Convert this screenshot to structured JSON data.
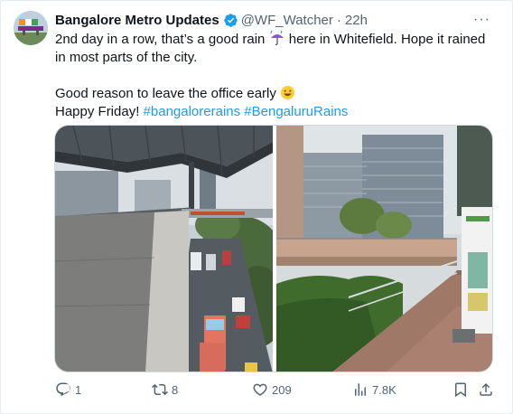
{
  "tweet": {
    "author_name": "Bangalore Metro Updates",
    "handle": "@WF_Watcher",
    "separator": "·",
    "time": "22h",
    "more_label": "···",
    "text": {
      "line1_part1": "2nd day in a row, that’s a good rain ",
      "line1_part2": " here in Whitefield. Hope it rained in most parts of the city.",
      "line2": "Good reason to leave the office early ",
      "line3_prefix": "Happy Friday! ",
      "hashtag1": "#bangalorerains",
      "hashtag_sep": " ",
      "hashtag2": "#BengaluruRains"
    },
    "emojis": [
      "umbrella-with-rain",
      "grinning-face"
    ],
    "media": [
      {
        "name": "metro-station-rainy-road-photo"
      },
      {
        "name": "office-campus-wet-walkway-photo"
      }
    ],
    "actions": {
      "replies": "1",
      "reposts": "8",
      "likes": "209",
      "views": "7.8K"
    },
    "colors": {
      "text": "#0f1419",
      "secondary": "#536471",
      "link": "#1d9bf0",
      "verified": "#1d9bf0"
    }
  }
}
